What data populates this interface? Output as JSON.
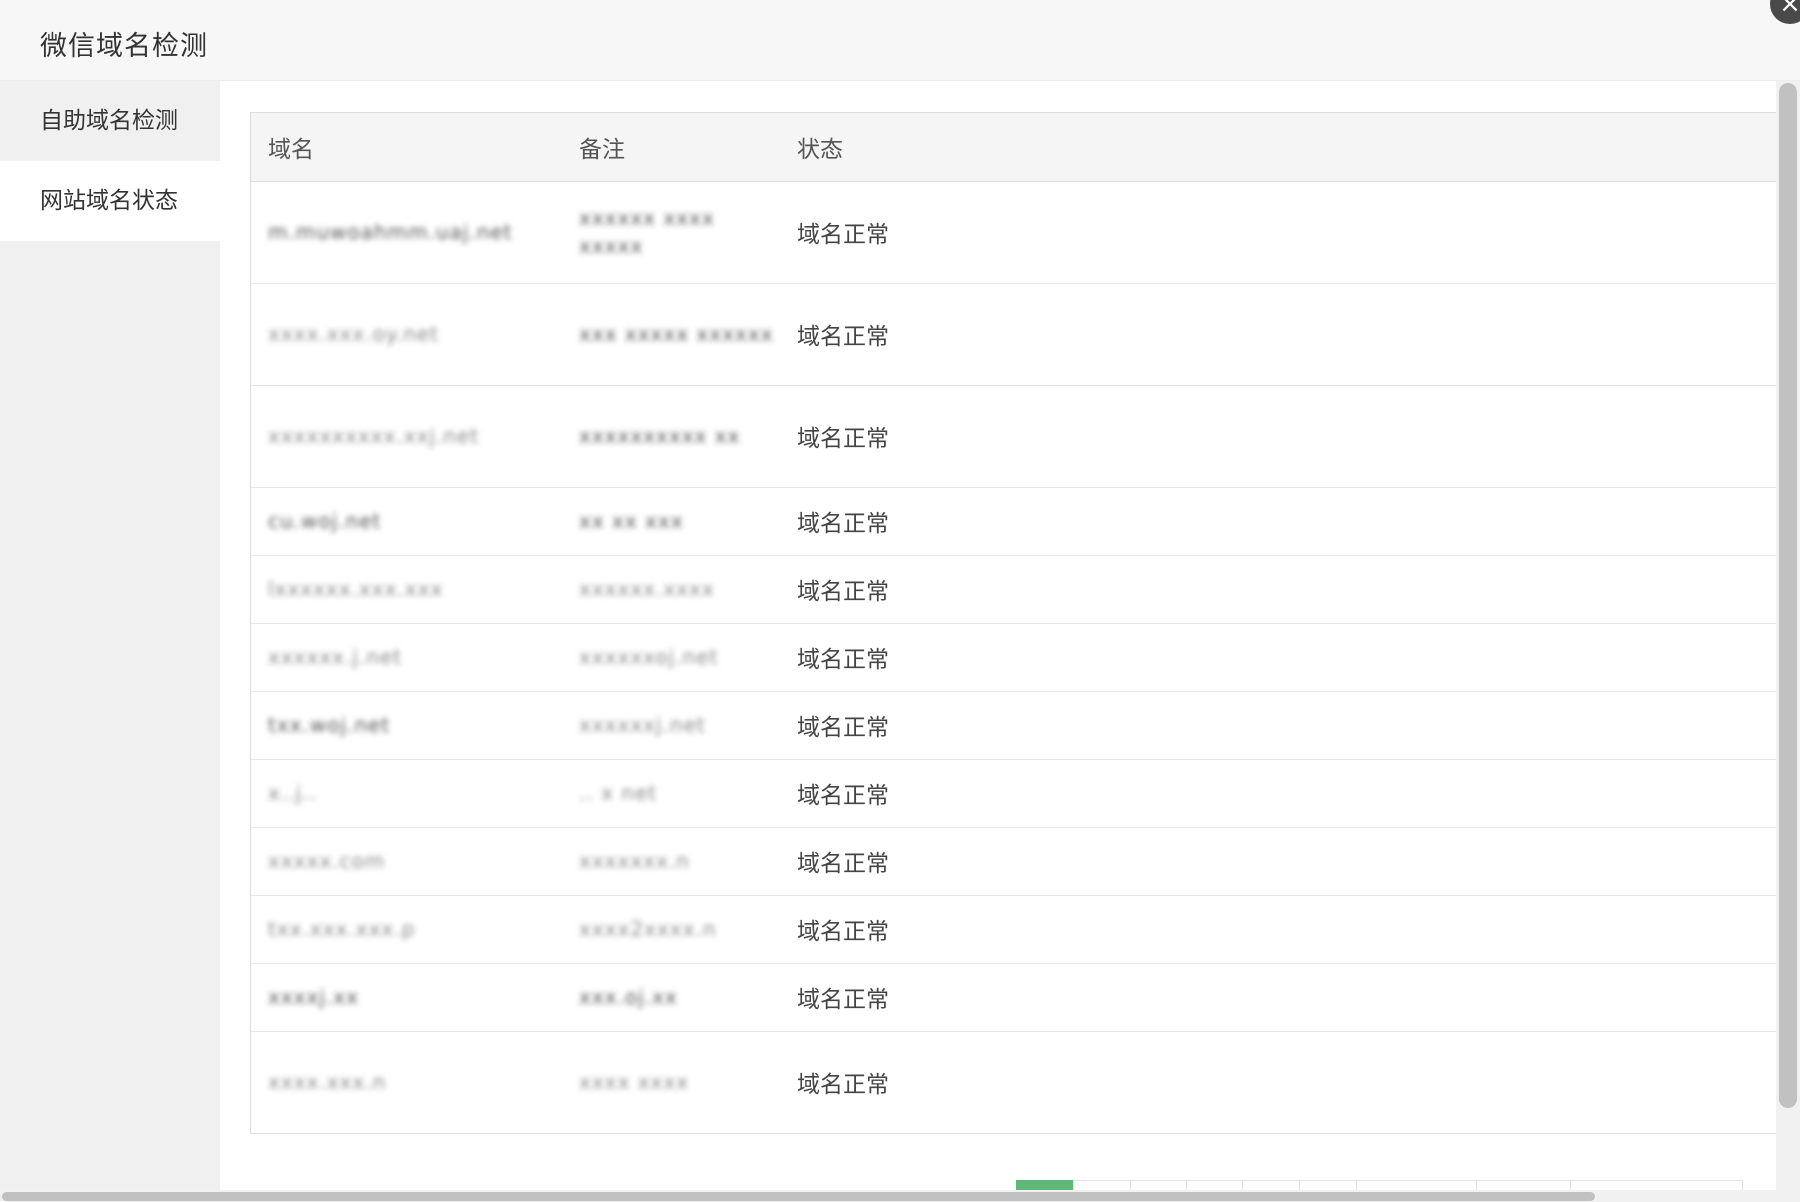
{
  "dialog": {
    "title": "微信域名检测",
    "close_symbol": "×"
  },
  "sidebar": {
    "items": [
      {
        "label": "自助域名检测",
        "active": false
      },
      {
        "label": "网站域名状态",
        "active": true
      }
    ]
  },
  "table": {
    "headers": {
      "domain": "域名",
      "note": "备注",
      "status": "状态"
    },
    "rows": [
      {
        "domain": "m.muwoahmm.uaj.net",
        "note": "xxxxxx xxxx xxxxx",
        "status": "域名正常"
      },
      {
        "domain": "xxxx.xxx.oy.net",
        "note": "xxx xxxxx xxxxxx",
        "status": "域名正常"
      },
      {
        "domain": "xxxxxxxxxx.xxj.net",
        "note": "xxxxxxxxxx xx",
        "status": "域名正常"
      },
      {
        "domain": "cu.woj.net",
        "note": "xx xx xxx",
        "status": "域名正常"
      },
      {
        "domain": "lxxxxxx.xxx.xxx",
        "note": "xxxxxx.xxxx",
        "status": "域名正常"
      },
      {
        "domain": "xxxxxx.j.net",
        "note": "xxxxxxoj.net",
        "status": "域名正常"
      },
      {
        "domain": "txx.woj.net",
        "note": "xxxxxxj.net",
        "status": "域名正常"
      },
      {
        "domain": "x..j..",
        "note": "..  x net",
        "status": "域名正常"
      },
      {
        "domain": "xxxxx.com",
        "note": "xxxxxxx.n",
        "status": "域名正常"
      },
      {
        "domain": "txx.xxx.xxx.p",
        "note": "xxxx2xxxx.n",
        "status": "域名正常"
      },
      {
        "domain": "xxxxj.xx",
        "note": "xxx.oj.xx",
        "status": "域名正常"
      },
      {
        "domain": "xxxx.xxx.n",
        "note": "xxxx xxxx",
        "status": "域名正常"
      }
    ]
  },
  "pagination": {
    "current_page": 1
  },
  "colors": {
    "pager_active": "#5fb878",
    "sidebar_bg": "#f0f0f0",
    "title_bg": "#f7f7f7"
  }
}
